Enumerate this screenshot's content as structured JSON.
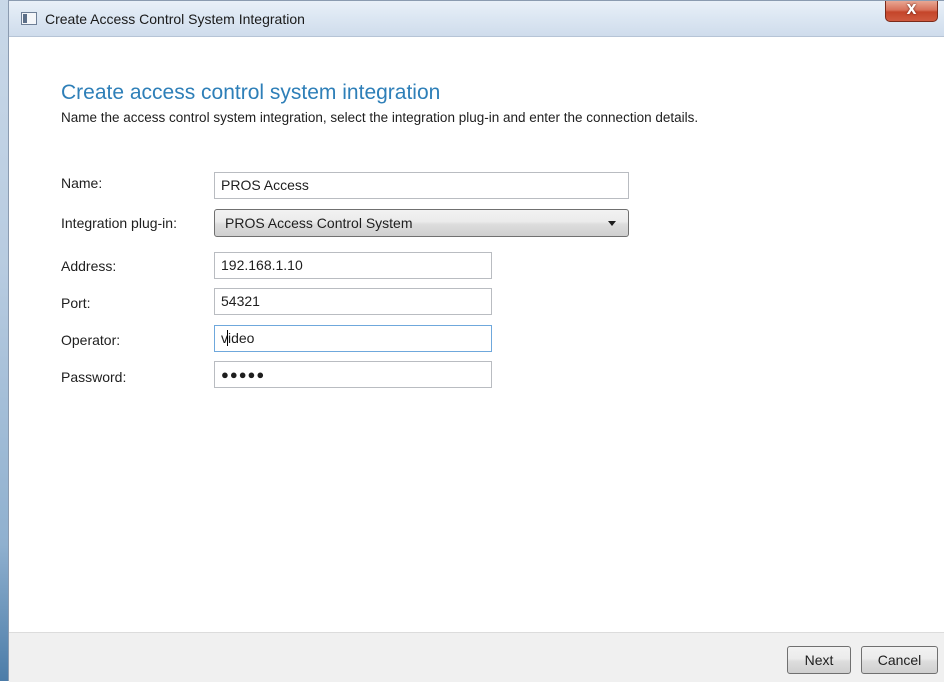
{
  "window": {
    "title": "Create Access Control System Integration",
    "close_label": "X"
  },
  "page": {
    "heading": "Create access control system integration",
    "subheading": "Name the access control system integration, select the integration plug-in and enter the connection details."
  },
  "form": {
    "name": {
      "label": "Name:",
      "value": "PROS Access"
    },
    "plugin": {
      "label": "Integration plug-in:",
      "value": "PROS Access Control System"
    },
    "address": {
      "label": "Address:",
      "value": "192.168.1.10"
    },
    "port": {
      "label": "Port:",
      "value": "54321"
    },
    "operator": {
      "label": "Operator:",
      "value_before_caret": "v",
      "value_after_caret": "ideo"
    },
    "password": {
      "label": "Password:",
      "masked_value": "●●●●●"
    }
  },
  "footer": {
    "next_label": "Next",
    "cancel_label": "Cancel"
  },
  "colors": {
    "heading": "#2e7fb8",
    "close_button": "#c4452a",
    "focus_border": "#6fa8dc"
  },
  "icons": {
    "window_icon": "app-window-icon",
    "dropdown": "chevron-down-icon"
  }
}
